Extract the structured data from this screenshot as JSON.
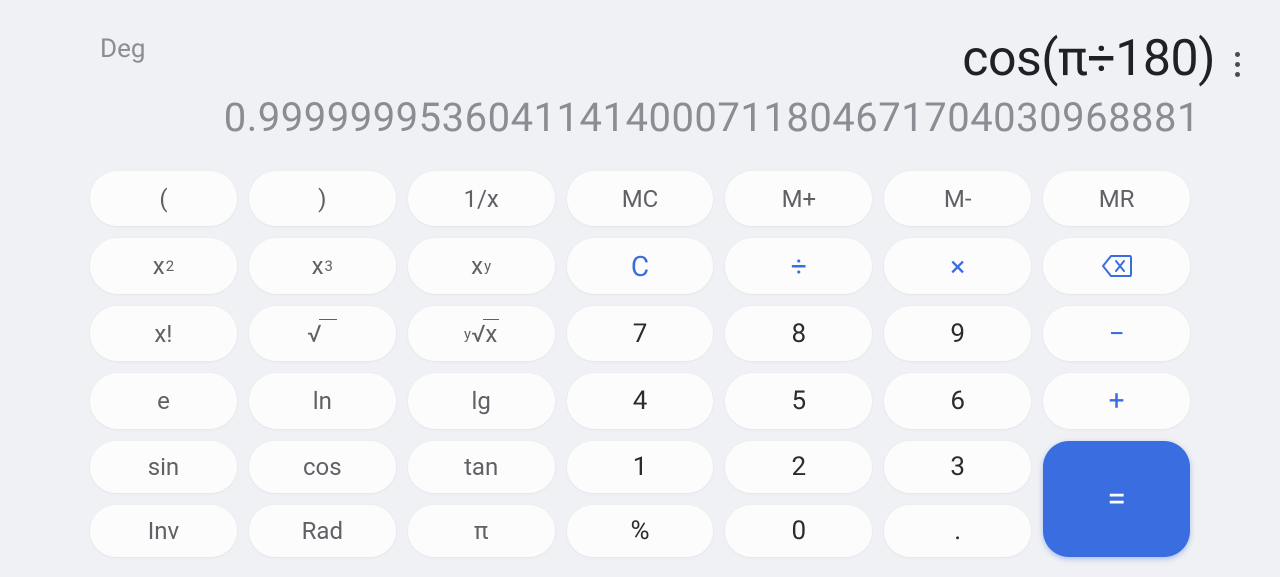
{
  "display": {
    "mode": "Deg",
    "expression": "cos(π÷180)",
    "result": "0.99999995360411414000711804671704030968881"
  },
  "keys": {
    "lparen": "(",
    "rparen": ")",
    "recip": "1/x",
    "mc": "MC",
    "mplus": "M+",
    "mminus": "M-",
    "mr": "MR",
    "sq_base": "x",
    "sq_exp": "2",
    "cube_base": "x",
    "cube_exp": "3",
    "pow_base": "x",
    "pow_exp": "y",
    "clear": "C",
    "divide": "÷",
    "multiply": "×",
    "fact": "x!",
    "sqrt": "√",
    "nroot_pre": "y",
    "nroot_post": "x",
    "d7": "7",
    "d8": "8",
    "d9": "9",
    "minus": "−",
    "e": "e",
    "ln": "ln",
    "lg": "lg",
    "d4": "4",
    "d5": "5",
    "d6": "6",
    "plus": "+",
    "sin": "sin",
    "cos": "cos",
    "tan": "tan",
    "d1": "1",
    "d2": "2",
    "d3": "3",
    "inv": "Inv",
    "rad": "Rad",
    "pi": "π",
    "percent": "%",
    "d0": "0",
    "dot": ".",
    "equals": "="
  }
}
